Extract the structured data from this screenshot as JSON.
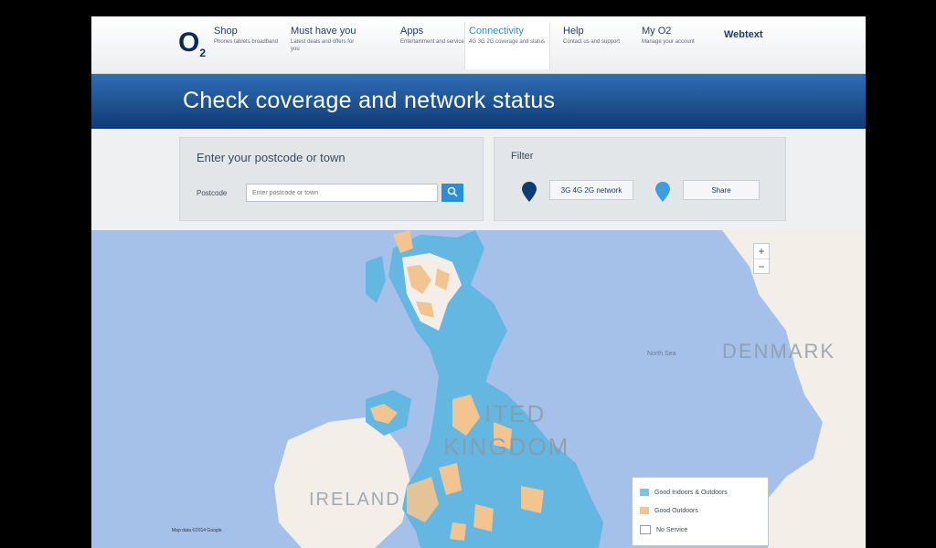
{
  "header": {
    "logo": "O",
    "logo_sub": "2",
    "nav": [
      {
        "title": "Shop",
        "sub": "Phones tablets broadband"
      },
      {
        "title": "Must have you",
        "sub": "Latest deals and offers for you"
      },
      {
        "title": "Apps",
        "sub": "Entertainment and services"
      },
      {
        "title": "Connectivity",
        "sub": "4G 3G 2G coverage and status"
      },
      {
        "title": "Help",
        "sub": "Contact us and support"
      },
      {
        "title": "My O2",
        "sub": "Manage your account"
      }
    ],
    "webtext": "Webtext"
  },
  "banner": {
    "title": "Check coverage and network status"
  },
  "search": {
    "title": "Enter your postcode or town",
    "label": "Postcode",
    "placeholder": "Enter postcode or town",
    "button_icon": "search-icon"
  },
  "filter": {
    "title": "Filter",
    "btn1": "3G 4G 2G network",
    "btn2": "Share"
  },
  "map": {
    "labels": {
      "denmark": "DENMARK",
      "united_l1": "ITED",
      "united_l2": "KINGDOM",
      "ireland": "IRELAND",
      "north_sea": "North Sea"
    },
    "zoom_in": "+",
    "zoom_out": "−",
    "legend": [
      {
        "label": "Good Indoors & Outdoors",
        "color": "#7fc4e6"
      },
      {
        "label": "Good Outdoors",
        "color": "#f2c48f"
      },
      {
        "label": "No Service",
        "color": "#ffffff"
      }
    ],
    "copyright": "Map data ©2014 Google"
  },
  "colors": {
    "brand_dark": "#0f3b73",
    "accent": "#2b8fd6",
    "sea": "#a5c1ea",
    "land": "#f3efe8",
    "coverage_good": "#63b7e0",
    "coverage_outdoor": "#f2c48f"
  }
}
